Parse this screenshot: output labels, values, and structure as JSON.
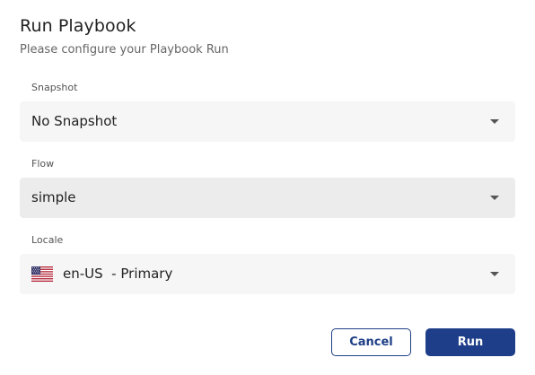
{
  "dialog": {
    "title": "Run Playbook",
    "subtitle": "Please configure your Playbook Run"
  },
  "fields": {
    "snapshot": {
      "label": "Snapshot",
      "value": "No Snapshot"
    },
    "flow": {
      "label": "Flow",
      "value": "simple"
    },
    "locale": {
      "label": "Locale",
      "value": "en-US  - Primary",
      "flag_icon": "us-flag-icon"
    }
  },
  "actions": {
    "cancel_label": "Cancel",
    "run_label": "Run"
  },
  "colors": {
    "primary": "#1e3e8a",
    "field_bg": "#f6f6f6",
    "field_active_bg": "#ececec"
  }
}
